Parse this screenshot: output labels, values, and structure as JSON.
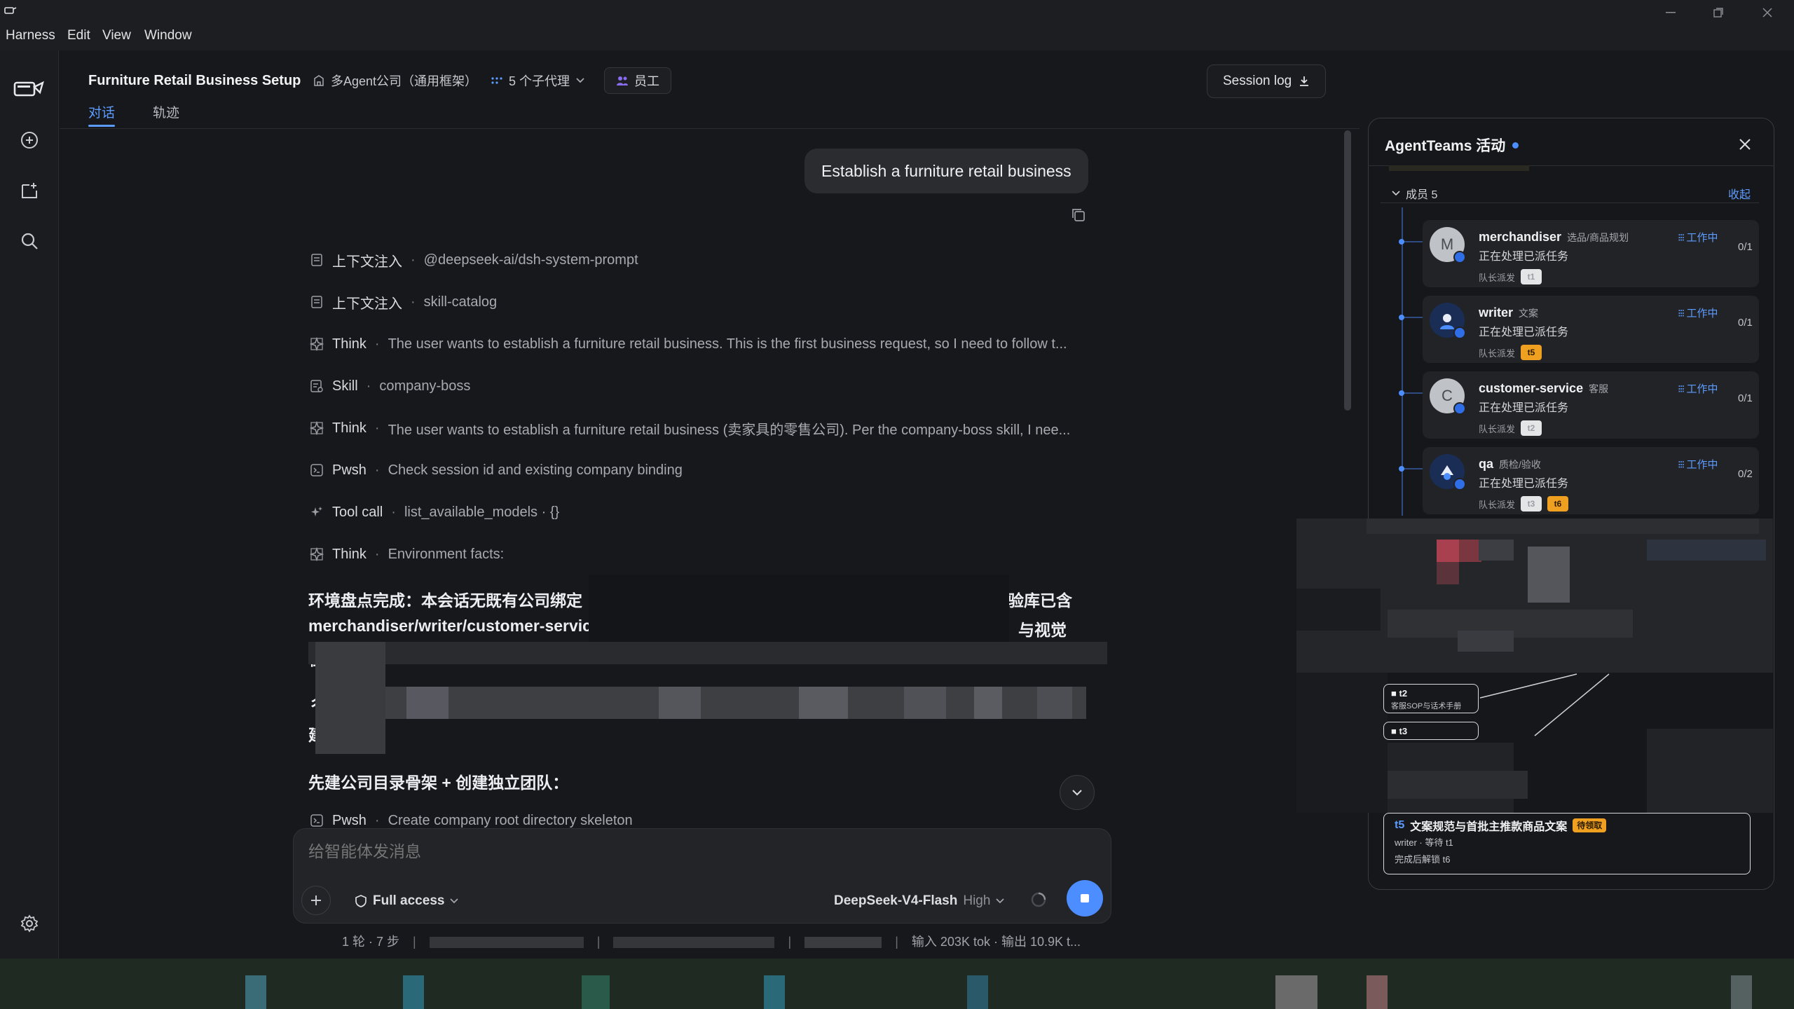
{
  "menu": {
    "items": [
      "Harness",
      "Edit",
      "View",
      "Window"
    ]
  },
  "header": {
    "title": "Furniture Retail Business Setup",
    "company": "多Agent公司（通用框架）",
    "agents": "5 个子代理",
    "staff": "员工",
    "tabs": [
      "对话",
      "轨迹"
    ],
    "session_log": "Session log"
  },
  "chat": {
    "user_message": "Establish a furniture retail business",
    "steps": [
      {
        "icon": "document-icon",
        "label": "上下文注入",
        "detail": "@deepseek-ai/dsh-system-prompt"
      },
      {
        "icon": "document-icon",
        "label": "上下文注入",
        "detail": "skill-catalog"
      },
      {
        "icon": "think-icon",
        "label": "Think",
        "detail": "The user wants to establish a furniture retail business. This is the first business request, so I need to follow t..."
      },
      {
        "icon": "skill-icon",
        "label": "Skill",
        "detail": "company-boss"
      },
      {
        "icon": "think-icon",
        "label": "Think",
        "detail": "The user wants to establish a furniture retail business (卖家具的零售公司). Per the company-boss skill, I nee..."
      },
      {
        "icon": "terminal-icon",
        "label": "Pwsh",
        "detail": "Check session id and existing company binding"
      },
      {
        "icon": "sparkle-icon",
        "label": "Tool call",
        "detail": "list_available_models · {}"
      },
      {
        "icon": "think-icon",
        "label": "Think",
        "detail": "Environment facts:"
      }
    ],
    "para1_line1_left": "环境盘点完成：本会话无既有公司绑定",
    "para1_line1_right": "验库已含",
    "para1_line2_left": "merchandiser/writer/customer-service",
    "para1_line2_right": "）与视觉",
    "para1_line3_left": "桂",
    "para2_left": "彳",
    "para3_left": "建",
    "section_heading": "先建公司目录骨架 + 创建独立团队：",
    "last_step": {
      "label": "Pwsh",
      "detail": "Create company root directory skeleton"
    }
  },
  "composer": {
    "placeholder": "给智能体发消息",
    "access": "Full access",
    "model": "DeepSeek-V4-Flash",
    "effort": "High"
  },
  "status_bar": {
    "rounds": "1 轮 · 7 步",
    "tokens": "输入 203K tok · 输出 10.9K t..."
  },
  "panel": {
    "title": "AgentTeams 活动",
    "members_label": "成员 5",
    "collapse": "收起",
    "members": [
      {
        "name": "merchandiser",
        "role": "选品/商品规划",
        "status": "工作中",
        "count": "0/1",
        "task": "正在处理已派任务",
        "lead": "队长派发",
        "tags": [
          {
            "text": "t1",
            "color": "gray"
          }
        ],
        "avatar": "M"
      },
      {
        "name": "writer",
        "role": "文案",
        "status": "工作中",
        "count": "0/1",
        "task": "正在处理已派任务",
        "lead": "队长派发",
        "tags": [
          {
            "text": "t5",
            "color": "orange"
          }
        ],
        "avatar": ""
      },
      {
        "name": "customer-service",
        "role": "客服",
        "status": "工作中",
        "count": "0/1",
        "task": "正在处理已派任务",
        "lead": "队长派发",
        "tags": [
          {
            "text": "t2",
            "color": "gray"
          }
        ],
        "avatar": "C"
      },
      {
        "name": "qa",
        "role": "质检/验收",
        "status": "工作中",
        "count": "0/2",
        "task": "正在处理已派任务",
        "lead": "队长派发",
        "tags": [
          {
            "text": "t3",
            "color": "gray"
          },
          {
            "text": "t6",
            "color": "orange"
          }
        ],
        "avatar": ""
      }
    ],
    "tasks": {
      "t2": {
        "id": "t2",
        "title": "客服SOP与话术手册"
      },
      "t3": {
        "id": "t3"
      },
      "t5": {
        "id": "t5",
        "title": "文案规范与首批主推款商品文案",
        "status": "待领取",
        "wait": "writer · 等待 t1",
        "unlock": "完成后解锁 t6"
      }
    }
  },
  "colors": {
    "accent": "#4c8dff",
    "orange": "#f0a020",
    "background": "#17181b"
  }
}
